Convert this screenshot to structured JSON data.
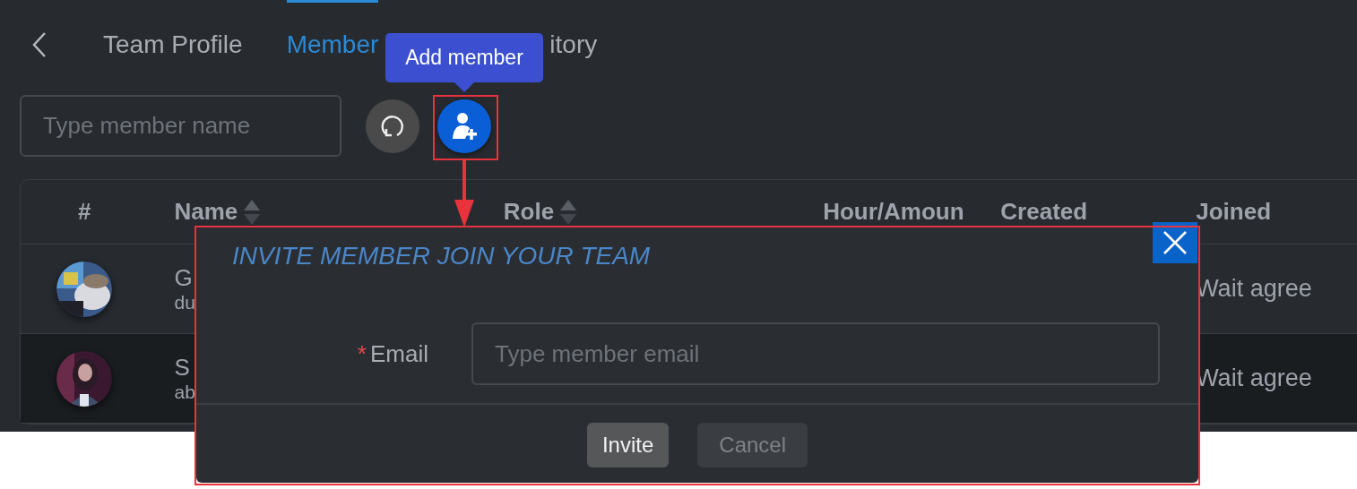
{
  "tabs": [
    {
      "label": "Team Profile",
      "selected": false
    },
    {
      "label": "Member",
      "selected": true
    },
    {
      "label": "itory",
      "selected": false
    }
  ],
  "search": {
    "placeholder": "Type member name"
  },
  "tooltip": {
    "text": "Add member"
  },
  "table": {
    "columns": [
      {
        "label": "#",
        "sortable": false
      },
      {
        "label": "Name",
        "sortable": true
      },
      {
        "label": "Role",
        "sortable": true
      },
      {
        "label": "Hour/Amoun",
        "sortable": false
      },
      {
        "label": "Created",
        "sortable": false
      },
      {
        "label": "Joined",
        "sortable": false
      }
    ],
    "rows": [
      {
        "name": "G",
        "email": "du",
        "joined": "Wait agree",
        "selected": false
      },
      {
        "name": "S",
        "email": "ab",
        "joined": "Wait agree",
        "selected": true
      }
    ]
  },
  "modal": {
    "title": "INVITE MEMBER JOIN YOUR TEAM",
    "fields": [
      {
        "label": "Email",
        "required_mark": "*",
        "placeholder": "Type member email"
      }
    ],
    "buttons": [
      {
        "label": "Invite",
        "kind": "primary"
      },
      {
        "label": "Cancel",
        "kind": "secondary"
      }
    ]
  }
}
